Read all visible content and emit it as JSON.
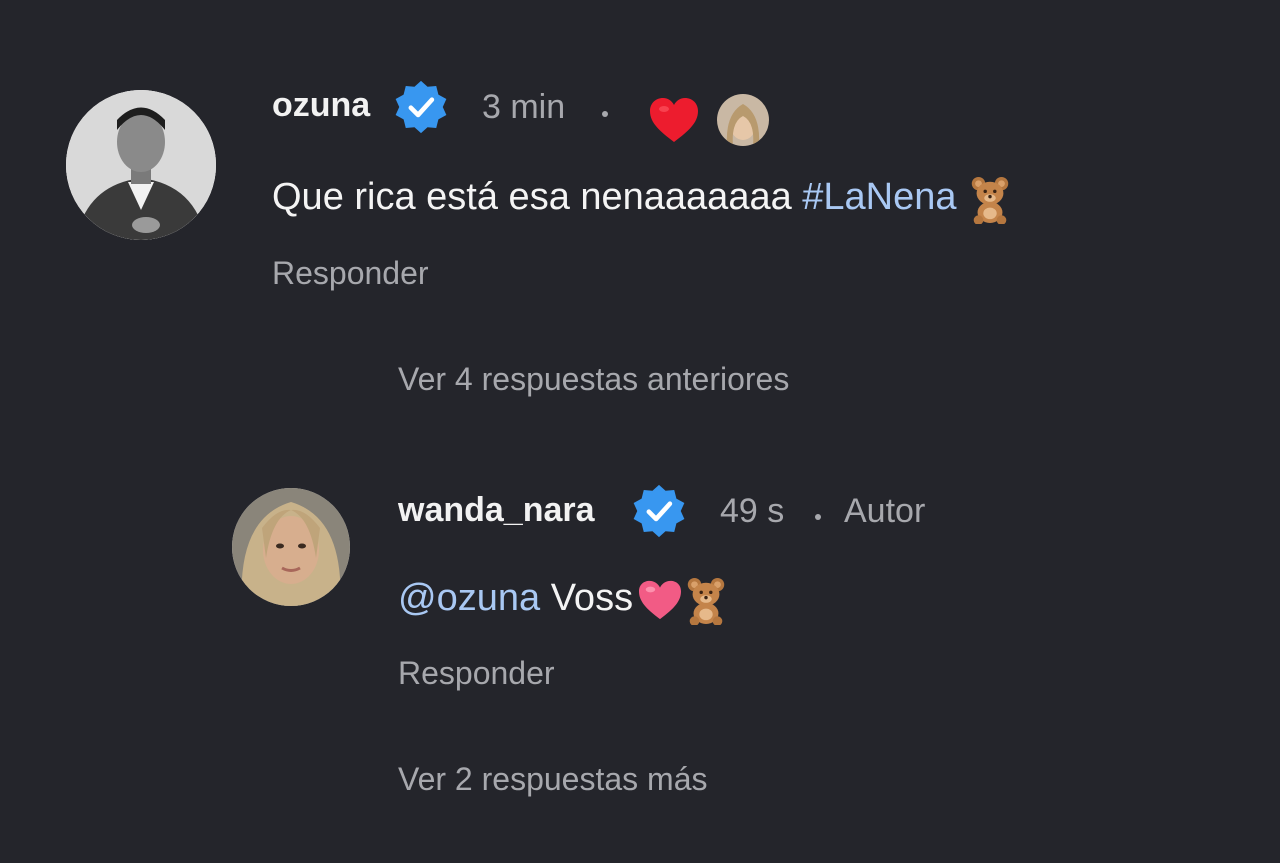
{
  "comment": {
    "username": "ozuna",
    "verified": true,
    "time": "3 min",
    "liked_by_author": true,
    "text_main": "Que rica está esa nenaaaaaaa",
    "hashtag": "#LaNena",
    "emoji": "teddy-bear",
    "reply_label": "Responder"
  },
  "view_previous_replies": "Ver 4 respuestas anteriores",
  "reply": {
    "username": "wanda_nara",
    "verified": true,
    "time": "49 s",
    "author_badge": "Autor",
    "mention": "@ozuna",
    "text": "Voss",
    "emojis": [
      "pink-heart",
      "teddy-bear"
    ],
    "reply_label": "Responder"
  },
  "view_more_replies": "Ver 2 respuestas más",
  "colors": {
    "background": "#24252b",
    "primary_text": "#f2f2f2",
    "secondary_text": "#a7a8ad",
    "link": "#a9c8f3",
    "verified_blue": "#3897f0",
    "like_heart": "#ed1c2e"
  }
}
